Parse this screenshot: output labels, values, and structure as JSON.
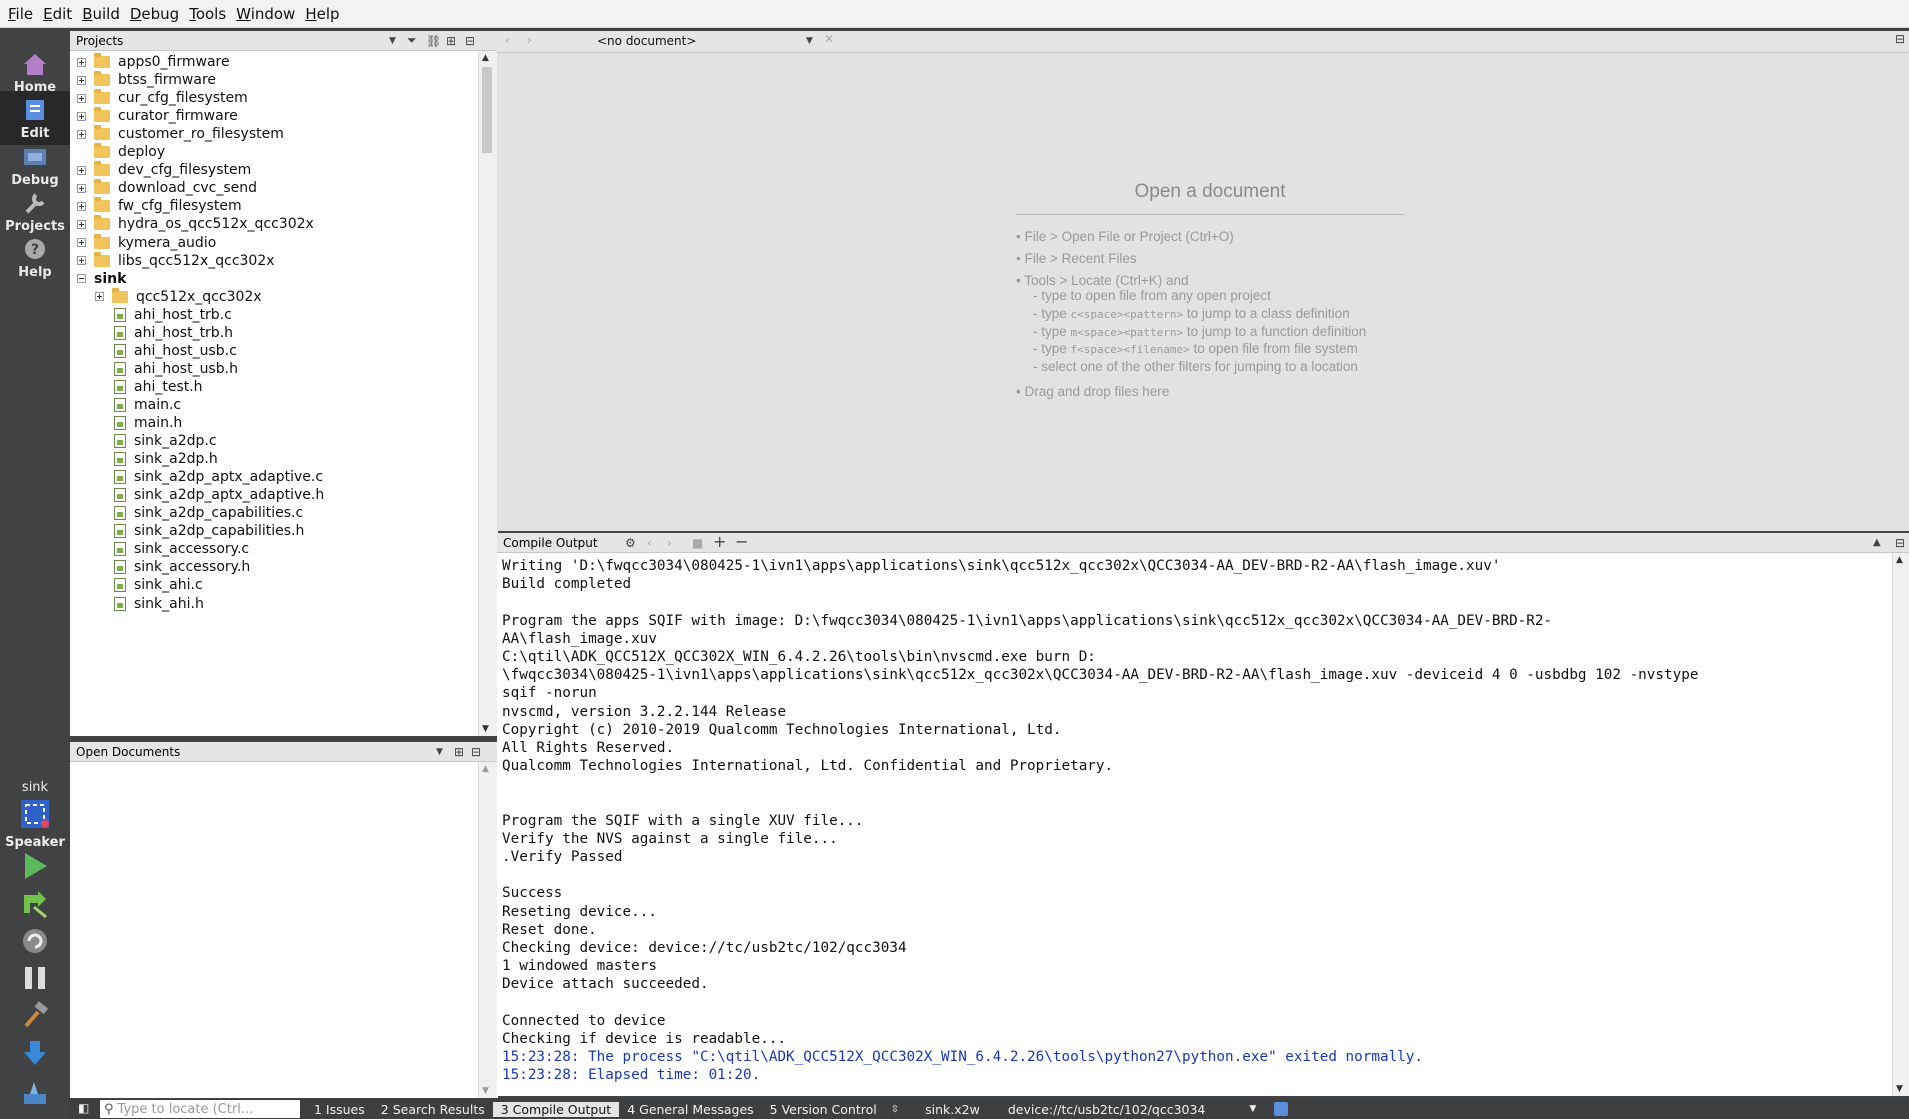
{
  "menu": [
    "File",
    "Edit",
    "Build",
    "Debug",
    "Tools",
    "Window",
    "Help"
  ],
  "modes": [
    {
      "label": "Home",
      "icon": "home-icon",
      "active": false
    },
    {
      "label": "Edit",
      "icon": "edit-icon",
      "active": true
    },
    {
      "label": "Debug",
      "icon": "debug-icon",
      "active": false
    },
    {
      "label": "Projects",
      "icon": "wrench-icon",
      "active": false
    },
    {
      "label": "Help",
      "icon": "help-icon",
      "active": false
    }
  ],
  "kit": {
    "project": "sink",
    "target": "Speaker"
  },
  "projects_pane": {
    "title": "Projects",
    "items": [
      {
        "label": "apps0_firmware",
        "type": "folder",
        "level": 0,
        "expander": "plus",
        "bold": false
      },
      {
        "label": "btss_firmware",
        "type": "folder",
        "level": 0,
        "expander": "plus",
        "bold": false
      },
      {
        "label": "cur_cfg_filesystem",
        "type": "folder",
        "level": 0,
        "expander": "plus",
        "bold": false
      },
      {
        "label": "curator_firmware",
        "type": "folder",
        "level": 0,
        "expander": "plus",
        "bold": false
      },
      {
        "label": "customer_ro_filesystem",
        "type": "folder",
        "level": 0,
        "expander": "plus",
        "bold": false
      },
      {
        "label": "deploy",
        "type": "folder",
        "level": 0,
        "expander": "none",
        "bold": false
      },
      {
        "label": "dev_cfg_filesystem",
        "type": "folder",
        "level": 0,
        "expander": "plus",
        "bold": false
      },
      {
        "label": "download_cvc_send",
        "type": "folder",
        "level": 0,
        "expander": "plus",
        "bold": false
      },
      {
        "label": "fw_cfg_filesystem",
        "type": "folder",
        "level": 0,
        "expander": "plus",
        "bold": false
      },
      {
        "label": "hydra_os_qcc512x_qcc302x",
        "type": "folder",
        "level": 0,
        "expander": "plus",
        "bold": false
      },
      {
        "label": "kymera_audio",
        "type": "folder",
        "level": 0,
        "expander": "plus",
        "bold": false
      },
      {
        "label": "libs_qcc512x_qcc302x",
        "type": "folder",
        "level": 0,
        "expander": "plus",
        "bold": false
      },
      {
        "label": "sink",
        "type": "none",
        "level": 0,
        "expander": "minus",
        "bold": true
      },
      {
        "label": "qcc512x_qcc302x",
        "type": "folder",
        "level": 1,
        "expander": "plus",
        "bold": false
      },
      {
        "label": "ahi_host_trb.c",
        "type": "file",
        "level": 1,
        "expander": "none",
        "bold": false
      },
      {
        "label": "ahi_host_trb.h",
        "type": "file",
        "level": 1,
        "expander": "none",
        "bold": false
      },
      {
        "label": "ahi_host_usb.c",
        "type": "file",
        "level": 1,
        "expander": "none",
        "bold": false
      },
      {
        "label": "ahi_host_usb.h",
        "type": "file",
        "level": 1,
        "expander": "none",
        "bold": false
      },
      {
        "label": "ahi_test.h",
        "type": "file",
        "level": 1,
        "expander": "none",
        "bold": false
      },
      {
        "label": "main.c",
        "type": "file",
        "level": 1,
        "expander": "none",
        "bold": false
      },
      {
        "label": "main.h",
        "type": "file",
        "level": 1,
        "expander": "none",
        "bold": false
      },
      {
        "label": "sink_a2dp.c",
        "type": "file",
        "level": 1,
        "expander": "none",
        "bold": false
      },
      {
        "label": "sink_a2dp.h",
        "type": "file",
        "level": 1,
        "expander": "none",
        "bold": false
      },
      {
        "label": "sink_a2dp_aptx_adaptive.c",
        "type": "file",
        "level": 1,
        "expander": "none",
        "bold": false
      },
      {
        "label": "sink_a2dp_aptx_adaptive.h",
        "type": "file",
        "level": 1,
        "expander": "none",
        "bold": false
      },
      {
        "label": "sink_a2dp_capabilities.c",
        "type": "file",
        "level": 1,
        "expander": "none",
        "bold": false
      },
      {
        "label": "sink_a2dp_capabilities.h",
        "type": "file",
        "level": 1,
        "expander": "none",
        "bold": false
      },
      {
        "label": "sink_accessory.c",
        "type": "file",
        "level": 1,
        "expander": "none",
        "bold": false
      },
      {
        "label": "sink_accessory.h",
        "type": "file",
        "level": 1,
        "expander": "none",
        "bold": false
      },
      {
        "label": "sink_ahi.c",
        "type": "file",
        "level": 1,
        "expander": "none",
        "bold": false
      },
      {
        "label": "sink_ahi.h",
        "type": "file",
        "level": 1,
        "expander": "none",
        "bold": false
      }
    ]
  },
  "open_documents": {
    "title": "Open Documents"
  },
  "editor": {
    "doc_selector": "<no document>",
    "open_title": "Open a document",
    "hints": [
      "• File > Open File or Project (Ctrl+O)",
      "• File > Recent Files",
      "• Tools > Locate (Ctrl+K) and"
    ],
    "locate_hints": [
      {
        "a": "- type to open file from any open project",
        "code": "",
        "b": ""
      },
      {
        "a": "- type ",
        "code": "c<space><pattern>",
        "b": " to jump to a class definition"
      },
      {
        "a": "- type ",
        "code": "m<space><pattern>",
        "b": " to jump to a function definition"
      },
      {
        "a": "- type ",
        "code": "f<space><filename>",
        "b": " to open file from file system"
      },
      {
        "a": "- select one of the other filters for jumping to a location",
        "code": "",
        "b": ""
      }
    ],
    "drag_hint": "• Drag and drop files here"
  },
  "compile_output": {
    "title": "Compile Output",
    "lines": [
      {
        "text": "Writing 'D:\\fwqcc3034\\080425-1\\ivn1\\apps\\applications\\sink\\qcc512x_qcc302x\\QCC3034-AA_DEV-BRD-R2-AA\\flash_image.xuv'",
        "blue": false
      },
      {
        "text": "Build completed",
        "blue": false
      },
      {
        "text": "",
        "blue": false
      },
      {
        "text": "Program the apps SQIF with image: D:\\fwqcc3034\\080425-1\\ivn1\\apps\\applications\\sink\\qcc512x_qcc302x\\QCC3034-AA_DEV-BRD-R2-",
        "blue": false
      },
      {
        "text": "AA\\flash_image.xuv",
        "blue": false
      },
      {
        "text": "C:\\qtil\\ADK_QCC512X_QCC302X_WIN_6.4.2.26\\tools\\bin\\nvscmd.exe burn D:",
        "blue": false
      },
      {
        "text": "\\fwqcc3034\\080425-1\\ivn1\\apps\\applications\\sink\\qcc512x_qcc302x\\QCC3034-AA_DEV-BRD-R2-AA\\flash_image.xuv -deviceid 4 0 -usbdbg 102 -nvstype",
        "blue": false
      },
      {
        "text": "sqif -norun",
        "blue": false
      },
      {
        "text": "nvscmd, version 3.2.2.144 Release",
        "blue": false
      },
      {
        "text": "Copyright (c) 2010-2019 Qualcomm Technologies International, Ltd.",
        "blue": false
      },
      {
        "text": "All Rights Reserved.",
        "blue": false
      },
      {
        "text": "Qualcomm Technologies International, Ltd. Confidential and Proprietary.",
        "blue": false
      },
      {
        "text": "",
        "blue": false
      },
      {
        "text": "",
        "blue": false
      },
      {
        "text": "Program the SQIF with a single XUV file...",
        "blue": false
      },
      {
        "text": "Verify the NVS against a single file...",
        "blue": false
      },
      {
        "text": ".Verify Passed",
        "blue": false
      },
      {
        "text": "",
        "blue": false
      },
      {
        "text": "Success",
        "blue": false
      },
      {
        "text": "Reseting device...",
        "blue": false
      },
      {
        "text": "Reset done.",
        "blue": false
      },
      {
        "text": "Checking device: device://tc/usb2tc/102/qcc3034",
        "blue": false
      },
      {
        "text": "1 windowed masters",
        "blue": false
      },
      {
        "text": "Device attach succeeded.",
        "blue": false
      },
      {
        "text": "",
        "blue": false
      },
      {
        "text": "Connected to device",
        "blue": false
      },
      {
        "text": "Checking if device is readable...",
        "blue": false
      },
      {
        "text": "15:23:28: The process \"C:\\qtil\\ADK_QCC512X_QCC302X_WIN_6.4.2.26\\tools\\python27\\python.exe\" exited normally.",
        "blue": true
      },
      {
        "text": "15:23:28: Elapsed time: 01:20.",
        "blue": true
      }
    ]
  },
  "statusbar": {
    "locate_placeholder": "Type to locate (Ctrl...",
    "tabs": [
      {
        "label": "1  Issues",
        "active": false
      },
      {
        "label": "2  Search Results",
        "active": false
      },
      {
        "label": "3  Compile Output",
        "active": true
      },
      {
        "label": "4  General Messages",
        "active": false
      },
      {
        "label": "5  Version Control",
        "active": false
      }
    ],
    "kit": "sink.x2w",
    "device": "device://tc/usb2tc/102/qcc3034"
  },
  "colors": {
    "accent": "#3c6fd1",
    "link_output": "#1a37b8",
    "sidebar": "#404244"
  }
}
